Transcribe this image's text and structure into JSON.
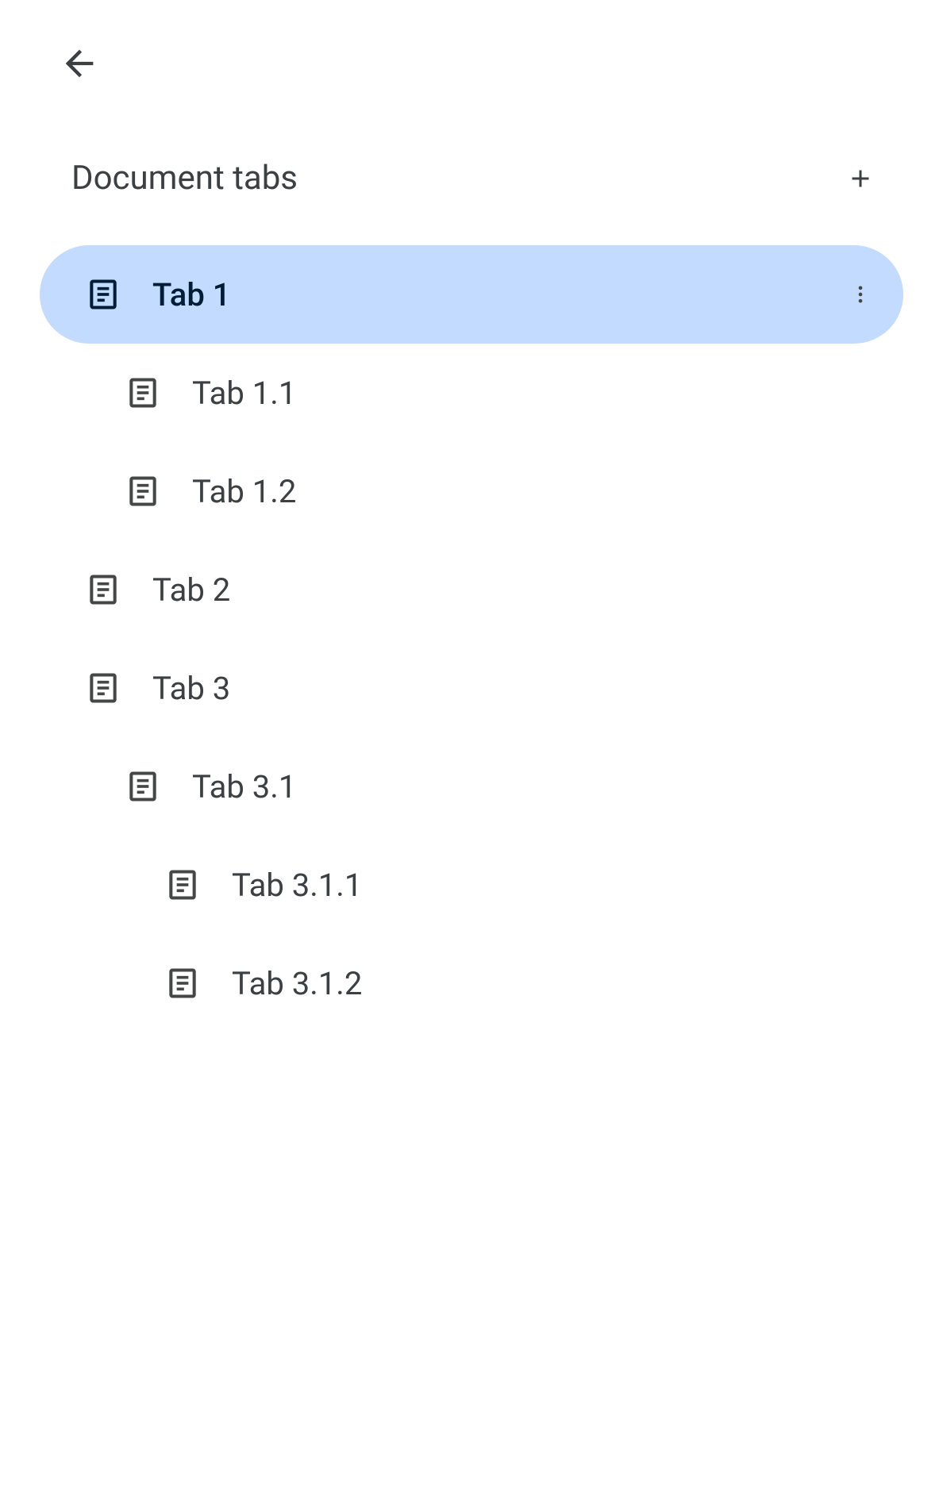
{
  "header": {
    "title": "Document tabs"
  },
  "tabs": [
    {
      "label": "Tab 1",
      "level": 0,
      "selected": true
    },
    {
      "label": "Tab 1.1",
      "level": 1,
      "selected": false
    },
    {
      "label": "Tab 1.2",
      "level": 1,
      "selected": false
    },
    {
      "label": "Tab 2",
      "level": 0,
      "selected": false
    },
    {
      "label": "Tab 3",
      "level": 0,
      "selected": false
    },
    {
      "label": "Tab 3.1",
      "level": 1,
      "selected": false
    },
    {
      "label": "Tab 3.1.1",
      "level": 2,
      "selected": false
    },
    {
      "label": "Tab 3.1.2",
      "level": 2,
      "selected": false
    }
  ],
  "colors": {
    "selected_bg": "#c2dbff",
    "selected_text": "#001d35",
    "text": "#3c4043",
    "icon": "#444746",
    "selected_icon": "#001d35"
  }
}
